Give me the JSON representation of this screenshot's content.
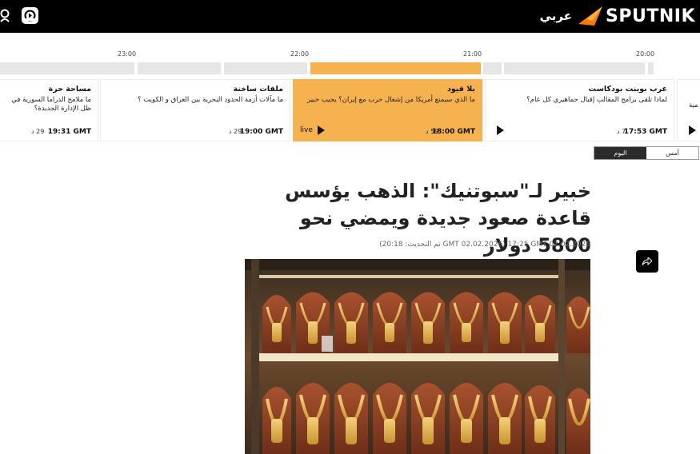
{
  "header": {
    "brand_name": "SPUTNIK",
    "brand_lang": "عربي"
  },
  "timeline": {
    "labels": [
      "23:00",
      "22:00",
      "21:00",
      "20:00"
    ]
  },
  "cards": [
    {
      "title": "مساحة حرة",
      "desc": "ما ملامح الدراما السورية في ظل الإدارة الجديدة؟",
      "time": "19:31 GMT",
      "duration": "29 د"
    },
    {
      "title": "ملفات ساخنة",
      "desc": "ما مآلات أزمة الحدود البحرية بين العراق و الكويت ؟",
      "time": "19:00 GMT",
      "duration": "29 د"
    },
    {
      "title": "بلا قيود",
      "desc": "ما الذي سيمنع أمريكا من إشعال حرب مع إيران؟ يجيب خبير",
      "time": "18:00 GMT",
      "duration": "59 د",
      "live": "live",
      "active": true
    },
    {
      "title": "عرب بوينت بودكاست",
      "desc": "لماذا تلقى برامج المقالب إقبال جماهيري كل عام؟",
      "time": "17:53 GMT",
      "duration": "7 د"
    },
    {
      "title": "",
      "desc": "مية",
      "time": "",
      "duration": ""
    }
  ],
  "day_toggle": {
    "today": "اليوم",
    "yesterday": "أمس"
  },
  "article": {
    "headline": "خبير لـ\"سبوتنيك\": الذهب يؤسس قاعدة صعود جديدة ويمضي نحو 5800 دولار",
    "published": "17:25 GMT 02.02.2026",
    "updated": "(تم التحديث: 20:18 GMT 02.02.2026)"
  },
  "icons": {
    "user": "user-icon",
    "radio": "radio-icon",
    "share": "share-icon",
    "play": "play-icon"
  },
  "colors": {
    "header_bg": "#000000",
    "accent": "#f7b250",
    "brand_orange": "#ff7a00"
  }
}
